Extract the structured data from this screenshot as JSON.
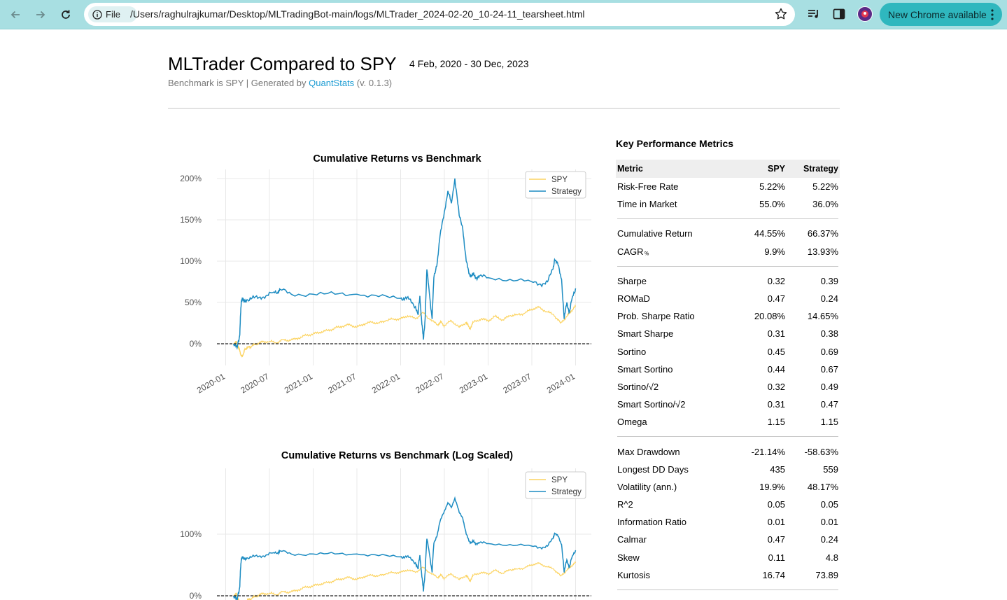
{
  "browser": {
    "chip_label": "File",
    "url": "/Users/raghulrajkumar/Desktop/MLTradingBot-main/logs/MLTrader_2024-02-20_10-24-11_tearsheet.html",
    "update_label": "New Chrome available",
    "toolbar_color": "#a8dfe2",
    "update_color": "#2fb7be"
  },
  "report": {
    "title": "MLTrader Compared to SPY",
    "date_range": "4 Feb, 2020 - 30 Dec, 2023",
    "subtitle_prefix": "Benchmark is SPY | Generated by ",
    "generator": "QuantStats",
    "version": " (v. 0.1.3)"
  },
  "chart_data": [
    {
      "type": "line",
      "title": "Cumulative Returns vs Benchmark",
      "yscale": "linear",
      "ylim": [
        -0.2,
        2.05
      ],
      "yticks": [
        0,
        0.5,
        1.0,
        1.5,
        2.0
      ],
      "ytick_labels": [
        "0%",
        "50%",
        "100%",
        "150%",
        "200%"
      ],
      "x_ticks": [
        "2020-01",
        "2020-07",
        "2021-01",
        "2021-07",
        "2022-01",
        "2022-07",
        "2023-01",
        "2023-07",
        "2024-01"
      ],
      "xlim": [
        2019.9,
        2024.18
      ],
      "grid": true,
      "legend": "top-right",
      "baseline": 0,
      "series": [
        {
          "name": "SPY",
          "color": "#fcd462",
          "x": [
            2020.09,
            2020.12,
            2020.15,
            2020.17,
            2020.19,
            2020.21,
            2020.23,
            2020.26,
            2020.3,
            2020.35,
            2020.42,
            2020.5,
            2020.58,
            2020.66,
            2020.74,
            2020.83,
            2020.92,
            2021.0,
            2021.08,
            2021.17,
            2021.25,
            2021.33,
            2021.42,
            2021.5,
            2021.58,
            2021.67,
            2021.75,
            2021.83,
            2021.92,
            2022.0,
            2022.08,
            2022.17,
            2022.25,
            2022.33,
            2022.42,
            2022.46,
            2022.5,
            2022.58,
            2022.67,
            2022.75,
            2022.79,
            2022.83,
            2022.92,
            2023.0,
            2023.08,
            2023.17,
            2023.25,
            2023.33,
            2023.42,
            2023.5,
            2023.58,
            2023.67,
            2023.75,
            2023.83,
            2023.9,
            2023.95,
            2024.0
          ],
          "y": [
            0.0,
            0.02,
            -0.05,
            -0.12,
            -0.16,
            -0.09,
            -0.06,
            -0.04,
            -0.03,
            0.0,
            0.02,
            0.03,
            0.01,
            0.05,
            0.04,
            0.07,
            0.1,
            0.12,
            0.14,
            0.16,
            0.19,
            0.21,
            0.23,
            0.2,
            0.24,
            0.26,
            0.25,
            0.28,
            0.3,
            0.3,
            0.34,
            0.3,
            0.38,
            0.3,
            0.23,
            0.26,
            0.22,
            0.28,
            0.2,
            0.26,
            0.18,
            0.26,
            0.3,
            0.28,
            0.33,
            0.29,
            0.34,
            0.35,
            0.37,
            0.42,
            0.44,
            0.39,
            0.35,
            0.25,
            0.33,
            0.4,
            0.45
          ]
        },
        {
          "name": "Strategy",
          "color": "#1d8cc2",
          "x": [
            2020.09,
            2020.13,
            2020.16,
            2020.17,
            2020.18,
            2020.19,
            2020.21,
            2020.24,
            2020.3,
            2020.38,
            2020.46,
            2020.54,
            2020.6,
            2020.62,
            2020.75,
            2021.0,
            2021.25,
            2021.5,
            2021.75,
            2022.0,
            2022.05,
            2022.1,
            2022.17,
            2022.2,
            2022.22,
            2022.24,
            2022.26,
            2022.28,
            2022.3,
            2022.33,
            2022.36,
            2022.38,
            2022.42,
            2022.45,
            2022.5,
            2022.54,
            2022.58,
            2022.62,
            2022.67,
            2022.71,
            2022.75,
            2022.78,
            2022.81,
            2022.83,
            2022.86,
            2022.9,
            2023.0,
            2023.25,
            2023.5,
            2023.6,
            2023.68,
            2023.74,
            2023.76,
            2023.8,
            2023.84,
            2023.87,
            2023.9,
            2023.93,
            2023.96,
            2024.0
          ],
          "y": [
            0.0,
            -0.05,
            0.1,
            0.35,
            0.52,
            0.55,
            0.5,
            0.53,
            0.55,
            0.56,
            0.58,
            0.62,
            0.63,
            0.66,
            0.6,
            0.6,
            0.6,
            0.6,
            0.57,
            0.55,
            0.55,
            0.54,
            0.45,
            0.35,
            0.58,
            0.28,
            0.05,
            0.3,
            0.9,
            0.6,
            0.3,
            0.8,
            1.0,
            1.3,
            1.6,
            1.85,
            1.7,
            2.0,
            1.55,
            1.4,
            1.0,
            0.85,
            0.82,
            0.84,
            0.8,
            0.82,
            0.8,
            0.78,
            0.75,
            0.72,
            0.75,
            0.9,
            1.02,
            0.95,
            0.78,
            0.3,
            0.5,
            0.38,
            0.55,
            0.67
          ]
        }
      ]
    },
    {
      "type": "line",
      "title": "Cumulative Returns vs Benchmark (Log Scaled)",
      "yscale": "log",
      "yticks": [
        0,
        1.0
      ],
      "ytick_labels": [
        "0%",
        "100%"
      ],
      "xlim": [
        2019.9,
        2024.18
      ],
      "grid": true,
      "legend": "top-right",
      "baseline": 0,
      "series": [
        {
          "name": "SPY",
          "color": "#fcd462"
        },
        {
          "name": "Strategy",
          "color": "#1d8cc2"
        }
      ]
    }
  ],
  "metrics": {
    "title": "Key Performance Metrics",
    "header": {
      "metric": "Metric",
      "spy": "SPY",
      "strategy": "Strategy"
    },
    "r1": {
      "metric": "Risk-Free Rate",
      "spy": "5.22%",
      "strategy": "5.22%"
    },
    "r2": {
      "metric": "Time in Market",
      "spy": "55.0%",
      "strategy": "36.0%"
    },
    "r3": {
      "metric": "Cumulative Return",
      "spy": "44.55%",
      "strategy": "66.37%"
    },
    "r4": {
      "metric": "CAGR",
      "metric_suffix": "﹪",
      "spy": "9.9%",
      "strategy": "13.93%"
    },
    "r5": {
      "metric": "Sharpe",
      "spy": "0.32",
      "strategy": "0.39"
    },
    "r6": {
      "metric": "ROMaD",
      "spy": "0.47",
      "strategy": "0.24"
    },
    "r7": {
      "metric": "Prob. Sharpe Ratio",
      "spy": "20.08%",
      "strategy": "14.65%"
    },
    "r8": {
      "metric": "Smart Sharpe",
      "spy": "0.31",
      "strategy": "0.38"
    },
    "r9": {
      "metric": "Sortino",
      "spy": "0.45",
      "strategy": "0.69"
    },
    "r10": {
      "metric": "Smart Sortino",
      "spy": "0.44",
      "strategy": "0.67"
    },
    "r11": {
      "metric": "Sortino/√2",
      "spy": "0.32",
      "strategy": "0.49"
    },
    "r12": {
      "metric": "Smart Sortino/√2",
      "spy": "0.31",
      "strategy": "0.47"
    },
    "r13": {
      "metric": "Omega",
      "spy": "1.15",
      "strategy": "1.15"
    },
    "r14": {
      "metric": "Max Drawdown",
      "spy": "-21.14%",
      "strategy": "-58.63%"
    },
    "r15": {
      "metric": "Longest DD Days",
      "spy": "435",
      "strategy": "559"
    },
    "r16": {
      "metric": "Volatility (ann.)",
      "spy": "19.9%",
      "strategy": "48.17%"
    },
    "r17": {
      "metric": "R^2",
      "spy": "0.05",
      "strategy": "0.05"
    },
    "r18": {
      "metric": "Information Ratio",
      "spy": "0.01",
      "strategy": "0.01"
    },
    "r19": {
      "metric": "Calmar",
      "spy": "0.47",
      "strategy": "0.24"
    },
    "r20": {
      "metric": "Skew",
      "spy": "0.11",
      "strategy": "4.8"
    },
    "r21": {
      "metric": "Kurtosis",
      "spy": "16.74",
      "strategy": "73.89"
    }
  }
}
